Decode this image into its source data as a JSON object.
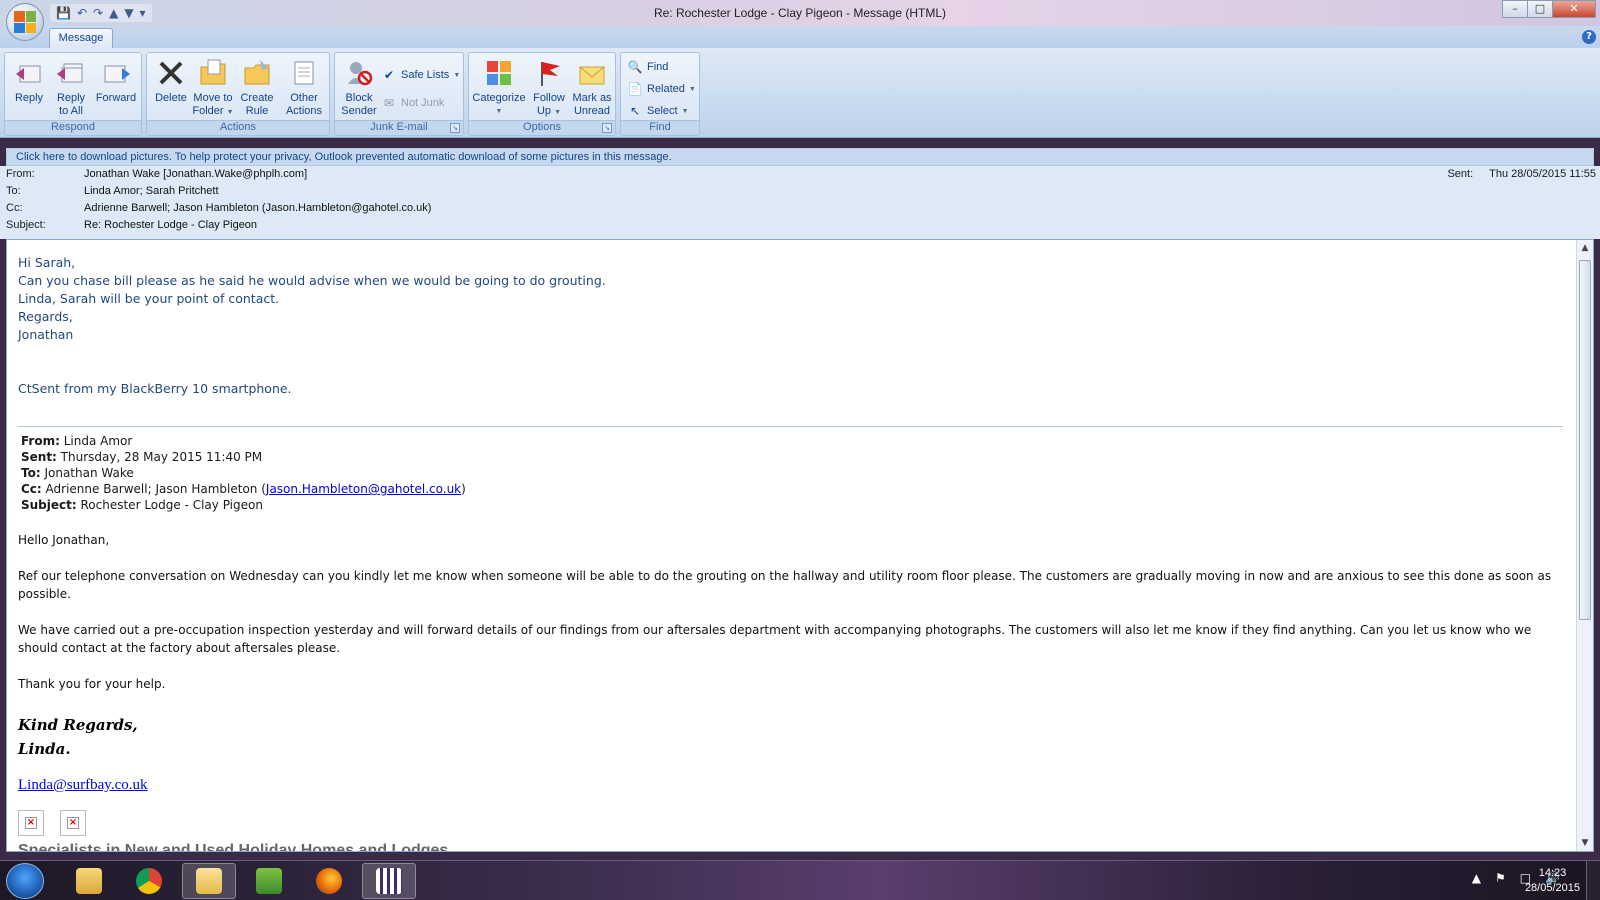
{
  "window": {
    "title": "Re: Rochester Lodge - Clay Pigeon - Message (HTML)",
    "minimize": "–",
    "maximize": "□",
    "close": "✕"
  },
  "ribbon": {
    "tab": "Message",
    "help": "?",
    "groups": {
      "respond": {
        "label": "Respond",
        "reply": "Reply",
        "reply_all_1": "Reply",
        "reply_all_2": "to All",
        "forward": "Forward"
      },
      "actions": {
        "label": "Actions",
        "delete": "Delete",
        "move_1": "Move to",
        "move_2": "Folder",
        "create_1": "Create",
        "create_2": "Rule",
        "other_1": "Other",
        "other_2": "Actions"
      },
      "junk": {
        "label": "Junk E-mail",
        "block_1": "Block",
        "block_2": "Sender",
        "safe_lists": "Safe Lists",
        "not_junk": "Not Junk"
      },
      "options": {
        "label": "Options",
        "categorize": "Categorize",
        "follow_1": "Follow",
        "follow_2": "Up",
        "mark_1": "Mark as",
        "mark_2": "Unread"
      },
      "find": {
        "label": "Find",
        "find": "Find",
        "related": "Related",
        "select": "Select"
      }
    }
  },
  "infobar": "Click here to download pictures. To help protect your privacy, Outlook prevented automatic download of some pictures in this message.",
  "header": {
    "from_label": "From:",
    "from": "Jonathan Wake [Jonathan.Wake@phplh.com]",
    "to_label": "To:",
    "to": "Linda Amor; Sarah Pritchett",
    "cc_label": "Cc:",
    "cc": "Adrienne Barwell; Jason Hambleton (Jason.Hambleton@gahotel.co.uk)",
    "subject_label": "Subject:",
    "subject": "Re: Rochester Lodge - Clay Pigeon",
    "sent_label": "Sent:",
    "sent": "Thu 28/05/2015 11:55"
  },
  "body": {
    "reply_lines": [
      "Hi Sarah,",
      "Can you chase bill please as he said he would advise when we would be going to do grouting.",
      "Linda, Sarah will be your point of contact.",
      "Regards,",
      "Jonathan"
    ],
    "blackberry": "CtSent from my BlackBerry 10 smartphone.",
    "quoted": {
      "from_label": "From:",
      "from": " Linda Amor",
      "sent_label": "Sent:",
      "sent": " Thursday, 28 May 2015 11:40 PM",
      "to_label": "To:",
      "to": " Jonathan Wake",
      "cc_label": "Cc:",
      "cc_prefix": " Adrienne Barwell; Jason Hambleton (",
      "cc_link": "Jason.Hambleton@gahotel.co.uk",
      "cc_suffix": ")",
      "subject_label": "Subject:",
      "subject": " Rochester Lodge - Clay Pigeon"
    },
    "greeting": "Hello Jonathan,",
    "para1": "Ref our telephone conversation on Wednesday can you kindly let me know when someone will be able to do the grouting on the hallway and utility room floor please.  The customers are gradually moving in now and are anxious to see this done as soon as possible.",
    "para2": "We have carried out a pre-occupation inspection yesterday and will forward details of our findings from our aftersales department with accompanying photographs.  The customers will also let me know if they find anything.  Can you let us know who we should contact at the factory about aftersales please.",
    "para3": "Thank you for your help.",
    "sig1": "Kind Regards,",
    "sig2": "Linda.",
    "sig_email": "Linda@surfbay.co.uk",
    "cutoff": "Specialists in New and Used Holiday Homes and Lodges"
  },
  "taskbar": {
    "time": "14:23",
    "date": "28/05/2015"
  },
  "colors": {
    "ribbon_text": "#15428b",
    "reply_text": "#1f497d",
    "link": "#0000ee"
  }
}
